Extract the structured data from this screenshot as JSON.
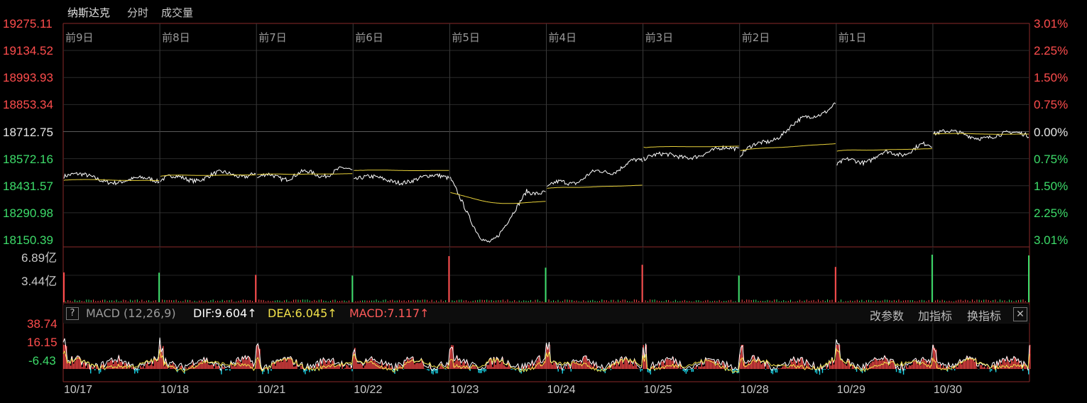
{
  "header": {
    "index_name": "纳斯达克",
    "tab_intraday": "分时",
    "tab_volume": "成交量"
  },
  "colors": {
    "up": "#ff4d4d",
    "down": "#3ddc6a",
    "neutral": "#e6e6e6",
    "price_line": "#ffffff",
    "avg_line": "#e8d13a",
    "dif_line": "#ffffff",
    "dea_line": "#f2e24a",
    "macd_pos": "#ff4a4a",
    "macd_neg": "#19d3e6",
    "grid": "#2a2a2a"
  },
  "price_axis": {
    "left": [
      "19275.11",
      "19134.52",
      "18993.93",
      "18853.34",
      "18712.75",
      "18572.16",
      "18431.57",
      "18290.98",
      "18150.39"
    ],
    "right": [
      "3.01%",
      "2.25%",
      "1.50%",
      "0.75%",
      "0.00%",
      "0.75%",
      "1.50%",
      "2.25%",
      "3.01%"
    ]
  },
  "day_labels": [
    "前9日",
    "前8日",
    "前7日",
    "前6日",
    "前5日",
    "前4日",
    "前3日",
    "前2日",
    "前1日"
  ],
  "volume_axis": [
    "6.89亿",
    "3.44亿"
  ],
  "macd": {
    "title": "MACD (12,26,9)",
    "dif": "DIF:9.604↑",
    "dea": "DEA:6.045↑",
    "macd": "MACD:7.117↑",
    "buttons": {
      "params": "改参数",
      "add": "加指标",
      "switch": "换指标",
      "help": "?",
      "close": "✕"
    },
    "axis": [
      "38.74",
      "16.15",
      "-6.43"
    ]
  },
  "x_dates": [
    "10/17",
    "10/18",
    "10/21",
    "10/22",
    "10/23",
    "10/24",
    "10/25",
    "10/28",
    "10/29",
    "10/30"
  ],
  "chart_data": {
    "type": "line",
    "title": "纳斯达克 分时",
    "x": [
      "10/17",
      "10/18",
      "10/21",
      "10/22",
      "10/23",
      "10/24",
      "10/25",
      "10/28",
      "10/29",
      "10/30"
    ],
    "reference_price": 18712.75,
    "ylim": [
      18150.39,
      19275.11
    ],
    "series": [
      {
        "values": [
          18450,
          18500,
          18510,
          18470,
          18400,
          18560,
          18620,
          18860,
          18640,
          18690
        ]
      },
      {
        "values": [
          18455,
          18490,
          18495,
          18525,
          18370,
          18415,
          18650,
          18625,
          18635,
          18700
        ]
      }
    ],
    "volume_ylim": [
      0,
      6.89
    ],
    "volume_spikes": [
      4.1,
      3.8,
      3.7,
      6.4,
      4.8,
      5.2,
      3.7,
      4.9,
      6.6
    ],
    "macd_ylim": [
      -6.43,
      38.74
    ]
  }
}
